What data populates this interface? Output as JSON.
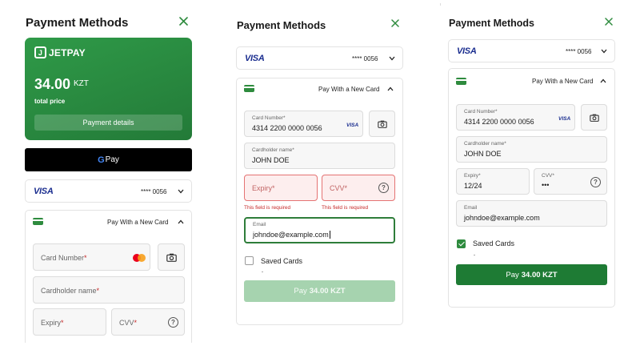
{
  "colors": {
    "brand_green": "#2e8b3e",
    "error_red": "#c62828",
    "visa_blue": "#1a2d8f"
  },
  "panel1": {
    "title": "Payment Methods",
    "close_icon": "close-icon",
    "jetpay": {
      "logo_text": "JETPAY",
      "amount": "34.00",
      "currency": "KZT",
      "subtitle": "total price",
      "details_button": "Payment details"
    },
    "gpay": {
      "g": "G",
      "label": "Pay"
    },
    "saved_card": {
      "brand": "VISA",
      "masked": "**** 0056"
    },
    "new_card": {
      "label": "Pay With a New Card",
      "card_number_placeholder": "Card Number",
      "cardholder_placeholder": "Cardholder name",
      "expiry_placeholder": "Expiry",
      "cvv_placeholder": "CVV",
      "required_mark": "*",
      "cvv_help": "?"
    }
  },
  "panel2": {
    "title": "Payment Methods",
    "saved_card": {
      "brand": "VISA",
      "masked": "**** 0056"
    },
    "new_card": {
      "label": "Pay With a New Card",
      "card_number_label": "Card Number",
      "card_number_value": "4314 2200 0000 0056",
      "card_brand": "VISA",
      "cardholder_label": "Cardholder name",
      "cardholder_value": "JOHN DOE",
      "expiry_placeholder": "Expiry",
      "cvv_placeholder": "CVV",
      "required_mark": "*",
      "expiry_error": "This field is required",
      "cvv_error": "This field is required",
      "cvv_help": "?",
      "email_label": "Email",
      "email_value": "johndoe@example.com"
    },
    "saved_cards_label": "Saved Cards",
    "saved_cards_checked": false,
    "pay_button": {
      "prefix": "Pay",
      "amount": "34.00 KZT",
      "enabled": false
    }
  },
  "panel3": {
    "title": "Payment Methods",
    "saved_card": {
      "brand": "VISA",
      "masked": "**** 0056"
    },
    "new_card": {
      "label": "Pay With a New Card",
      "card_number_label": "Card Number",
      "card_number_value": "4314 2200 0000 0056",
      "card_brand": "VISA",
      "cardholder_label": "Cardholder name",
      "cardholder_value": "JOHN DOE",
      "expiry_label": "Expiry",
      "expiry_value": "12/24",
      "cvv_label": "CVV",
      "cvv_value": "•••",
      "required_mark": "*",
      "cvv_help": "?",
      "email_label": "Email",
      "email_value": "johndoe@example.com"
    },
    "saved_cards_label": "Saved Cards",
    "saved_cards_checked": true,
    "pay_button": {
      "prefix": "Pay",
      "amount": "34.00 KZT",
      "enabled": true
    }
  }
}
